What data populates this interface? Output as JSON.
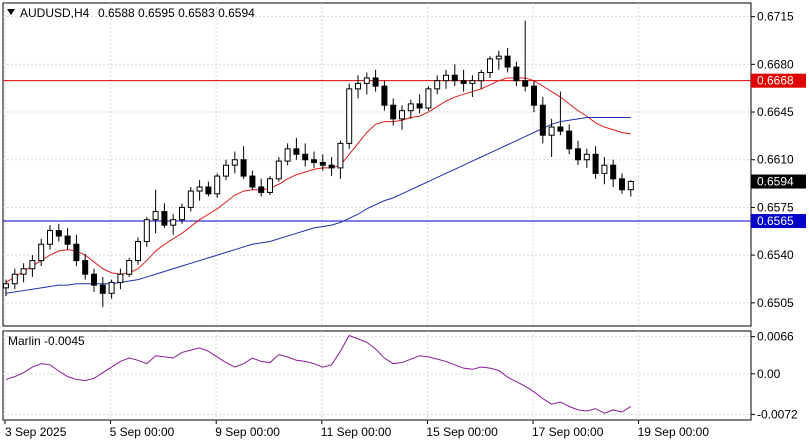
{
  "chart_data": [
    {
      "type": "candlestick",
      "symbol_label": "AUDUSD,H4",
      "ohlc_label": "0.6588 0.6595 0.6583 0.6594",
      "y_ticks": [
        "0.6715",
        "0.6680",
        "0.6645",
        "0.6610",
        "0.6575",
        "0.6540",
        "0.6505"
      ],
      "y_tick_values": [
        0.6715,
        0.668,
        0.6645,
        0.661,
        0.6575,
        0.654,
        0.6505
      ],
      "ylim": [
        0.6488,
        0.6725
      ],
      "x_ticks": [
        "3 Sep 2025",
        "5 Sep 00:00",
        "9 Sep 00:00",
        "11 Sep 00:00",
        "15 Sep 00:00",
        "17 Sep 00:00",
        "19 Sep 00:00"
      ],
      "levels": [
        {
          "value": 0.6668,
          "label": "0.6668",
          "color": "#e00000"
        },
        {
          "value": 0.6565,
          "label": "0.6565",
          "color": "#0000c8"
        }
      ],
      "current_price": {
        "value": 0.6594,
        "label": "0.6594"
      },
      "bull_color": "#ffffff",
      "bear_color": "#000000",
      "candles": [
        [
          0.6516,
          0.6522,
          0.651,
          0.6519
        ],
        [
          0.6519,
          0.653,
          0.6515,
          0.6526
        ],
        [
          0.6526,
          0.6534,
          0.652,
          0.653
        ],
        [
          0.653,
          0.654,
          0.6524,
          0.6536
        ],
        [
          0.6536,
          0.6552,
          0.6532,
          0.6548
        ],
        [
          0.6548,
          0.6562,
          0.6544,
          0.6558
        ],
        [
          0.6558,
          0.6563,
          0.655,
          0.6554
        ],
        [
          0.6554,
          0.656,
          0.6544,
          0.6548
        ],
        [
          0.6548,
          0.6555,
          0.6532,
          0.6536
        ],
        [
          0.6536,
          0.6541,
          0.6522,
          0.6526
        ],
        [
          0.6526,
          0.653,
          0.6513,
          0.6518
        ],
        [
          0.6518,
          0.6524,
          0.6502,
          0.6512
        ],
        [
          0.6512,
          0.6522,
          0.6508,
          0.652
        ],
        [
          0.652,
          0.653,
          0.6515,
          0.6526
        ],
        [
          0.6526,
          0.6538,
          0.6524,
          0.6536
        ],
        [
          0.6536,
          0.6553,
          0.6533,
          0.655
        ],
        [
          0.655,
          0.6568,
          0.6546,
          0.6566
        ],
        [
          0.6566,
          0.6588,
          0.6556,
          0.6572
        ],
        [
          0.6572,
          0.6578,
          0.656,
          0.6562
        ],
        [
          0.6562,
          0.657,
          0.6555,
          0.6566
        ],
        [
          0.6566,
          0.6578,
          0.6563,
          0.6575
        ],
        [
          0.6575,
          0.659,
          0.6572,
          0.6587
        ],
        [
          0.6587,
          0.6595,
          0.658,
          0.659
        ],
        [
          0.659,
          0.6594,
          0.6583,
          0.6585
        ],
        [
          0.6585,
          0.66,
          0.6582,
          0.6598
        ],
        [
          0.6598,
          0.661,
          0.6595,
          0.6606
        ],
        [
          0.6606,
          0.6616,
          0.66,
          0.661
        ],
        [
          0.661,
          0.662,
          0.6596,
          0.6598
        ],
        [
          0.6598,
          0.6602,
          0.6588,
          0.659
        ],
        [
          0.659,
          0.6596,
          0.6583,
          0.6586
        ],
        [
          0.6586,
          0.6598,
          0.6584,
          0.6596
        ],
        [
          0.6596,
          0.6612,
          0.6594,
          0.6609
        ],
        [
          0.6609,
          0.6622,
          0.6606,
          0.6618
        ],
        [
          0.6618,
          0.6626,
          0.661,
          0.6614
        ],
        [
          0.6614,
          0.6622,
          0.6605,
          0.661
        ],
        [
          0.661,
          0.6616,
          0.6604,
          0.6608
        ],
        [
          0.6608,
          0.6614,
          0.6602,
          0.6606
        ],
        [
          0.6606,
          0.6612,
          0.6598,
          0.6604
        ],
        [
          0.6604,
          0.6624,
          0.6596,
          0.6622
        ],
        [
          0.6622,
          0.6666,
          0.6618,
          0.6662
        ],
        [
          0.6662,
          0.6672,
          0.6655,
          0.6666
        ],
        [
          0.6666,
          0.6674,
          0.6658,
          0.667
        ],
        [
          0.667,
          0.6676,
          0.666,
          0.6664
        ],
        [
          0.6664,
          0.6668,
          0.6646,
          0.665
        ],
        [
          0.665,
          0.6655,
          0.6635,
          0.664
        ],
        [
          0.664,
          0.665,
          0.6632,
          0.6646
        ],
        [
          0.6646,
          0.6654,
          0.664,
          0.6651
        ],
        [
          0.6651,
          0.6658,
          0.6644,
          0.6648
        ],
        [
          0.6648,
          0.6664,
          0.6646,
          0.6662
        ],
        [
          0.6662,
          0.6672,
          0.6658,
          0.6668
        ],
        [
          0.6668,
          0.6676,
          0.6662,
          0.6672
        ],
        [
          0.6672,
          0.668,
          0.6664,
          0.6668
        ],
        [
          0.6668,
          0.6676,
          0.666,
          0.6666
        ],
        [
          0.6666,
          0.6672,
          0.6656,
          0.6668
        ],
        [
          0.6668,
          0.6676,
          0.6662,
          0.6674
        ],
        [
          0.6674,
          0.6686,
          0.667,
          0.6684
        ],
        [
          0.6684,
          0.669,
          0.6676,
          0.6686
        ],
        [
          0.6686,
          0.6692,
          0.6674,
          0.6678
        ],
        [
          0.6678,
          0.6682,
          0.6664,
          0.6668
        ],
        [
          0.6668,
          0.6712,
          0.666,
          0.6664
        ],
        [
          0.6664,
          0.6668,
          0.6645,
          0.665
        ],
        [
          0.665,
          0.6656,
          0.6622,
          0.6628
        ],
        [
          0.6628,
          0.664,
          0.6612,
          0.6634
        ],
        [
          0.6634,
          0.666,
          0.6628,
          0.6631
        ],
        [
          0.6631,
          0.6636,
          0.6614,
          0.6618
        ],
        [
          0.6618,
          0.6624,
          0.6606,
          0.661
        ],
        [
          0.661,
          0.6618,
          0.6604,
          0.6614
        ],
        [
          0.6614,
          0.662,
          0.6596,
          0.66
        ],
        [
          0.66,
          0.6612,
          0.6592,
          0.6606
        ],
        [
          0.6606,
          0.661,
          0.659,
          0.6596
        ],
        [
          0.6596,
          0.66,
          0.6585,
          0.6588
        ],
        [
          0.6588,
          0.6595,
          0.6583,
          0.6594
        ]
      ],
      "series": [
        {
          "values": [
            0.652,
            0.6524,
            0.6528,
            0.6532,
            0.6536,
            0.654,
            0.6543,
            0.6544,
            0.6543,
            0.654,
            0.6535,
            0.653,
            0.6527,
            0.6526,
            0.6527,
            0.653,
            0.6536,
            0.6543,
            0.6548,
            0.6552,
            0.6556,
            0.6561,
            0.6566,
            0.657,
            0.6574,
            0.6579,
            0.6584,
            0.6587,
            0.6588,
            0.6588,
            0.6589,
            0.6592,
            0.6596,
            0.6599,
            0.6601,
            0.6603,
            0.6604,
            0.6604,
            0.6606,
            0.6614,
            0.6622,
            0.663,
            0.6636,
            0.6638,
            0.6638,
            0.6639,
            0.6641,
            0.6642,
            0.6645,
            0.6649,
            0.6653,
            0.6656,
            0.6658,
            0.666,
            0.6662,
            0.6665,
            0.6668,
            0.667,
            0.667,
            0.667,
            0.6668,
            0.6664,
            0.666,
            0.6656,
            0.6651,
            0.6646,
            0.6642,
            0.6637,
            0.6634,
            0.6632,
            0.663,
            0.6629
          ]
        },
        {
          "values": [
            0.6512,
            0.6513,
            0.6514,
            0.6515,
            0.6516,
            0.6517,
            0.6518,
            0.6518,
            0.6519,
            0.6519,
            0.6519,
            0.6519,
            0.6519,
            0.652,
            0.6521,
            0.6522,
            0.6524,
            0.6526,
            0.6528,
            0.653,
            0.6532,
            0.6534,
            0.6536,
            0.6538,
            0.654,
            0.6542,
            0.6544,
            0.6546,
            0.6548,
            0.6549,
            0.655,
            0.6552,
            0.6554,
            0.6556,
            0.6558,
            0.656,
            0.6561,
            0.6562,
            0.6564,
            0.6567,
            0.657,
            0.6574,
            0.6577,
            0.658,
            0.6582,
            0.6585,
            0.6588,
            0.6591,
            0.6594,
            0.6597,
            0.66,
            0.6603,
            0.6606,
            0.6609,
            0.6612,
            0.6615,
            0.6618,
            0.6621,
            0.6624,
            0.6627,
            0.663,
            0.6633,
            0.6636,
            0.6638,
            0.6639,
            0.664,
            0.6641,
            0.6641,
            0.6641,
            0.6641,
            0.6641,
            0.6641
          ]
        }
      ]
    },
    {
      "type": "line",
      "indicator_label": "Marlin -0.0045",
      "y_ticks": [
        "0.0066",
        "0.00",
        "-0.0072"
      ],
      "y_tick_values": [
        0.0066,
        0.0,
        -0.0072
      ],
      "ylim": [
        -0.0082,
        0.0076
      ],
      "series": [
        {
          "values": [
            -0.001,
            -0.0005,
            0.0002,
            0.0012,
            0.0018,
            0.0016,
            0.0005,
            -0.0005,
            -0.001,
            -0.0012,
            -0.0008,
            0.0002,
            0.0012,
            0.0022,
            0.0028,
            0.0024,
            0.0018,
            0.0032,
            0.003,
            0.0028,
            0.0038,
            0.0042,
            0.0046,
            0.004,
            0.003,
            0.002,
            0.0012,
            0.0018,
            0.0028,
            0.0022,
            0.002,
            0.0034,
            0.003,
            0.0024,
            0.0022,
            0.0018,
            0.0012,
            0.0016,
            0.004,
            0.0068,
            0.0062,
            0.0056,
            0.0044,
            0.0028,
            0.0018,
            0.002,
            0.0026,
            0.0032,
            0.003,
            0.0026,
            0.0022,
            0.0016,
            0.001,
            0.0008,
            0.0012,
            0.001,
            0.0006,
            -0.0006,
            -0.0014,
            -0.0022,
            -0.0032,
            -0.0044,
            -0.0054,
            -0.005,
            -0.0058,
            -0.0064,
            -0.0066,
            -0.0062,
            -0.007,
            -0.0064,
            -0.0068,
            -0.0058
          ]
        }
      ]
    }
  ]
}
